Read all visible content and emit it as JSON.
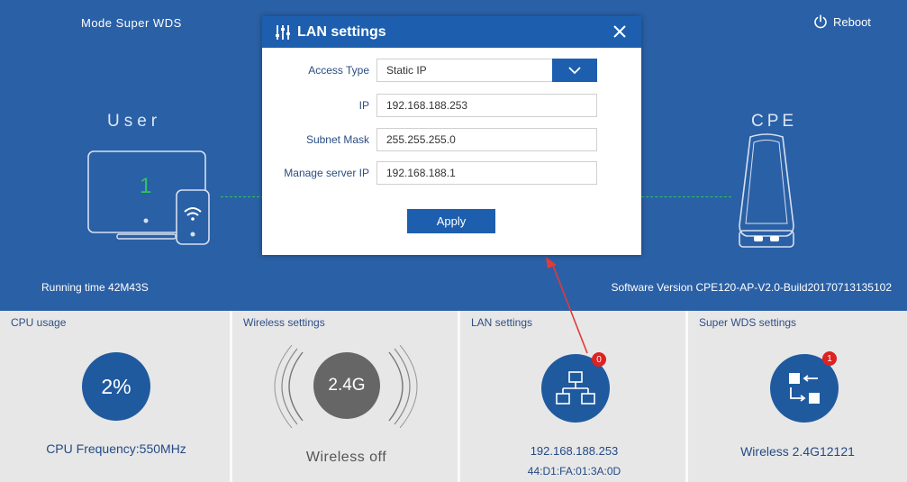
{
  "header": {
    "mode_text": "Mode  Super WDS",
    "reboot_label": "Reboot"
  },
  "topology": {
    "user_label": "User",
    "user_count": "1",
    "cpe_label": "CPE"
  },
  "status": {
    "running_time": "Running time  42M43S",
    "software_version": "Software Version   CPE120-AP-V2.0-Build20170713135102"
  },
  "panels": {
    "cpu": {
      "title": "CPU usage",
      "value": "2%",
      "frequency": "CPU Frequency:550MHz"
    },
    "wireless": {
      "title": "Wireless settings",
      "band": "2.4G",
      "state": "Wireless off"
    },
    "lan": {
      "title": "LAN settings",
      "badge": "0",
      "ip": "192.168.188.253",
      "mac": "44:D1:FA:01:3A:0D"
    },
    "wds": {
      "title": "Super WDS settings",
      "badge": "1",
      "text": "Wireless 2.4G12121"
    }
  },
  "dialog": {
    "title": "LAN settings",
    "access_type_label": "Access Type",
    "access_type_value": "Static IP",
    "ip_label": "IP",
    "ip_value": "192.168.188.253",
    "subnet_label": "Subnet Mask",
    "subnet_value": "255.255.255.0",
    "manage_label": "Manage server IP",
    "manage_value": "192.168.188.1",
    "apply_label": "Apply"
  },
  "colors": {
    "top_background": "#2a60a6",
    "dialog_header": "#1d5fae",
    "accent_circle": "#1f5a9f",
    "badge": "#dd2222",
    "user_count": "#2fc55e",
    "arrow": "#e23a3a"
  },
  "icons": [
    "power-icon",
    "sliders-icon",
    "close-icon",
    "chevron-down-icon",
    "monitor-icon",
    "phone-icon",
    "wifi-icon",
    "cpe-device-icon",
    "network-icon",
    "wds-arrows-icon",
    "wireless-waves-icon"
  ]
}
